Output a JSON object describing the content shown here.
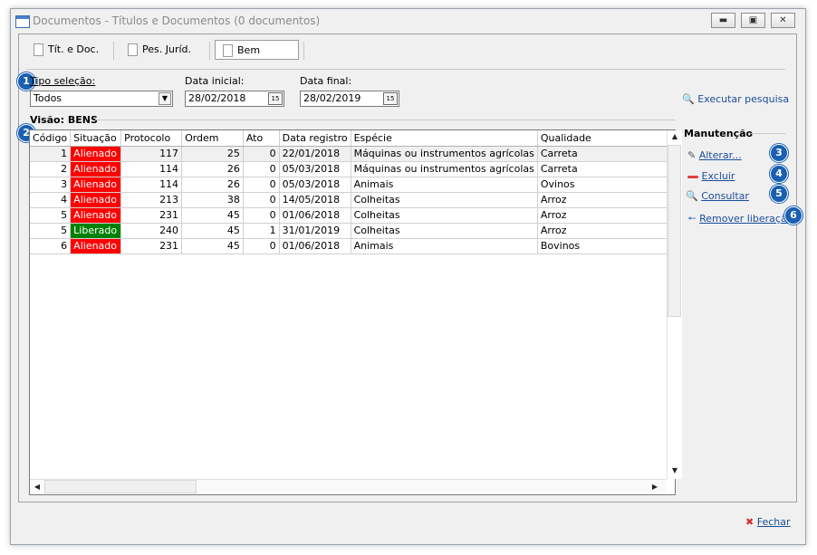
{
  "window": {
    "title": "Documentos - Títulos e Documentos (0 documentos)"
  },
  "tabs": [
    {
      "label": "Tít. e Doc."
    },
    {
      "label": "Pes. Juríd."
    },
    {
      "label": "Bem"
    }
  ],
  "filters": {
    "tipo_label": "Tipo seleção:",
    "tipo_value": "Todos",
    "data_inicial_label": "Data inicial:",
    "data_inicial_value": "28/02/2018",
    "data_final_label": "Data final:",
    "data_final_value": "28/02/2019",
    "calendar_glyph": "15",
    "executar_label": "Executar pesquisa"
  },
  "view_title": "Visão: BENS",
  "table": {
    "columns": [
      "Código",
      "Situação",
      "Protocolo",
      "Ordem",
      "Ato",
      "Data registro",
      "Espécie",
      "Qualidade"
    ],
    "rows": [
      {
        "codigo": "1",
        "situacao": "Alienado",
        "protocolo": "117",
        "ordem": "25",
        "ato": "0",
        "data": "22/01/2018",
        "especie": "Máquinas ou instrumentos agrícolas",
        "qualidade": "Carreta"
      },
      {
        "codigo": "2",
        "situacao": "Alienado",
        "protocolo": "114",
        "ordem": "26",
        "ato": "0",
        "data": "05/03/2018",
        "especie": "Máquinas ou instrumentos agrícolas",
        "qualidade": "Carreta"
      },
      {
        "codigo": "3",
        "situacao": "Alienado",
        "protocolo": "114",
        "ordem": "26",
        "ato": "0",
        "data": "05/03/2018",
        "especie": "Animais",
        "qualidade": "Ovinos"
      },
      {
        "codigo": "4",
        "situacao": "Alienado",
        "protocolo": "213",
        "ordem": "38",
        "ato": "0",
        "data": "14/05/2018",
        "especie": "Colheitas",
        "qualidade": "Arroz"
      },
      {
        "codigo": "5",
        "situacao": "Alienado",
        "protocolo": "231",
        "ordem": "45",
        "ato": "0",
        "data": "01/06/2018",
        "especie": "Colheitas",
        "qualidade": "Arroz"
      },
      {
        "codigo": "5",
        "situacao": "Liberado",
        "protocolo": "240",
        "ordem": "45",
        "ato": "1",
        "data": "31/01/2019",
        "especie": "Colheitas",
        "qualidade": "Arroz"
      },
      {
        "codigo": "6",
        "situacao": "Alienado",
        "protocolo": "231",
        "ordem": "45",
        "ato": "0",
        "data": "01/06/2018",
        "especie": "Animais",
        "qualidade": "Bovinos"
      }
    ]
  },
  "status_colors": {
    "Alienado": "#ff0000",
    "Liberado": "#008000"
  },
  "manutencao": {
    "title": "Manutenção",
    "alterar": "Alterar...",
    "excluir": "Excluir",
    "consultar": "Consultar",
    "remover": "Remover liberação"
  },
  "badges": [
    "1",
    "2",
    "3",
    "4",
    "5",
    "6"
  ],
  "footer": {
    "fechar": "Fechar"
  }
}
